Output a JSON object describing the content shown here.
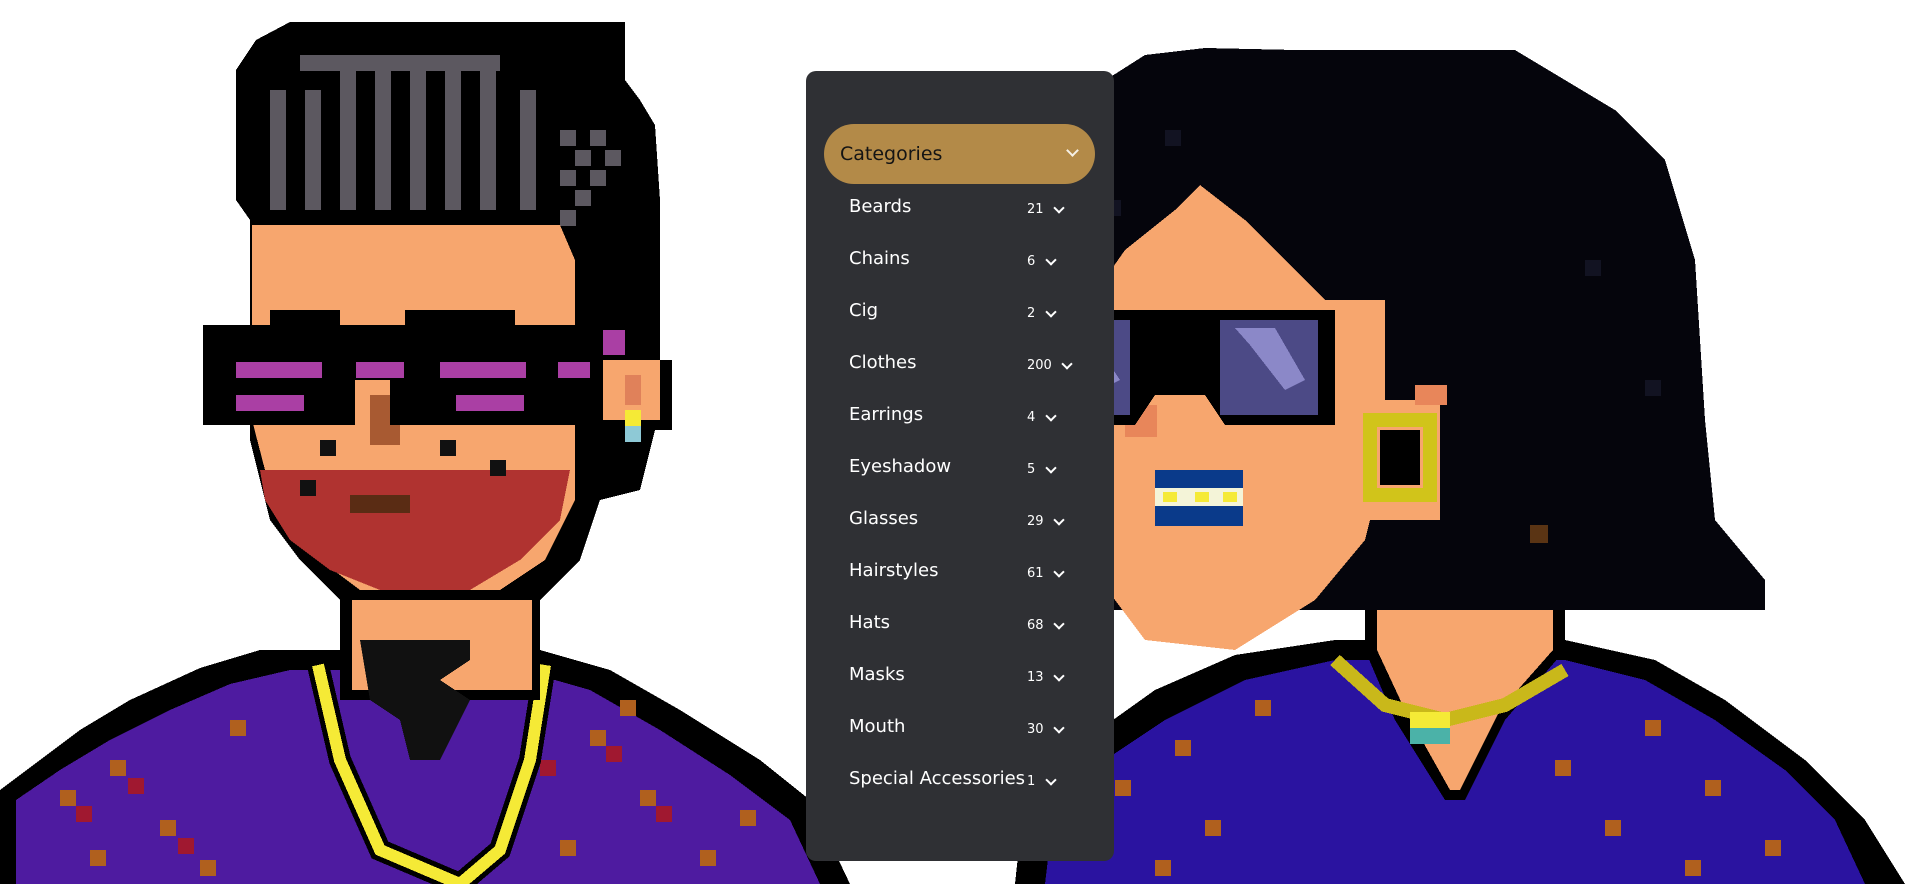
{
  "filter_panel": {
    "categories_label": "Categories",
    "accent_color": "#b38a48",
    "panel_color": "#2f3034",
    "items": [
      {
        "label": "Beards",
        "count": "21"
      },
      {
        "label": "Chains",
        "count": "6"
      },
      {
        "label": "Cig",
        "count": "2"
      },
      {
        "label": "Clothes",
        "count": "200"
      },
      {
        "label": "Earrings",
        "count": "4"
      },
      {
        "label": "Eyeshadow",
        "count": "5"
      },
      {
        "label": "Glasses",
        "count": "29"
      },
      {
        "label": "Hairstyles",
        "count": "61"
      },
      {
        "label": "Hats",
        "count": "68"
      },
      {
        "label": "Masks",
        "count": "13"
      },
      {
        "label": "Mouth",
        "count": "30"
      },
      {
        "label": "Special Accessories",
        "count": "1"
      }
    ]
  },
  "icons": {
    "categories_toggle": "chevron-down-icon",
    "item_toggle": "chevron-down-icon"
  }
}
